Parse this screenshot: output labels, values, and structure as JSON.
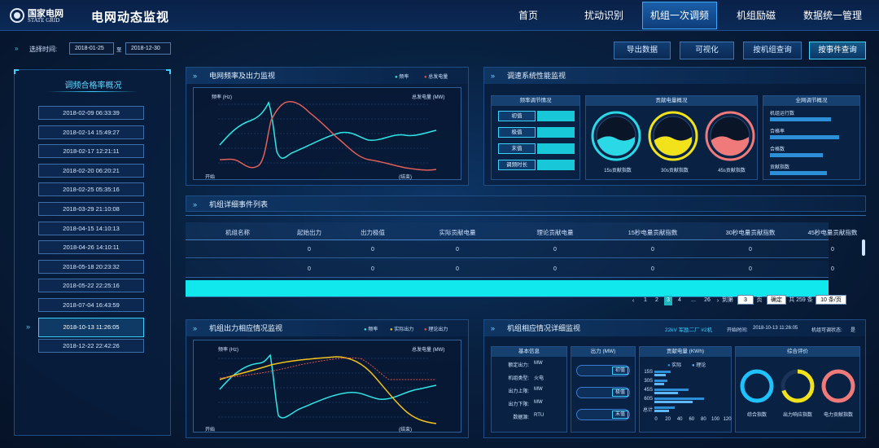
{
  "header": {
    "logo_cn": "国家电网",
    "logo_en": "STATE GRID",
    "app_title": "电网动态监视",
    "nav": [
      "首页",
      "扰动识别",
      "机组一次调频",
      "机组励磁",
      "数据统一管理"
    ],
    "active_nav": "机组一次调频"
  },
  "filter": {
    "label": "选择时间:",
    "start": "2018-01-25",
    "sep": "至",
    "end": "2018-12-30"
  },
  "actions": [
    "导出数据",
    "可视化",
    "按机组查询",
    "按事件查询"
  ],
  "left": {
    "title": "调频合格率概况",
    "items": [
      "2018-02-09 06:33:39",
      "2018-02-14 15:49:27",
      "2018-02-17 12:21:11",
      "2018-02-20 06:20:21",
      "2018-02-25 05:35:16",
      "2018-03-29 21:10:08",
      "2018-04-15 14:10:13",
      "2018-04-26 14:10:11",
      "2018-05-18 20:23:32",
      "2018-05-22 22:25:16",
      "2018-07-04 16:43:59",
      "2018-10-13 11:26:05",
      "2018-12-22 22:42:26"
    ],
    "selected_index": 11
  },
  "freq_panel": {
    "title": "电网频率及出力监视",
    "legend": [
      "频率",
      "总发电量"
    ],
    "y_left_label": "频率 (Hz)",
    "y_right_label": "总发电量 (MW)",
    "x_start": "开始",
    "x_end": "(结束)",
    "series_colors": [
      "#2ee6e6",
      "#e07a7a"
    ]
  },
  "perf_panel": {
    "title": "调速系统性能监视",
    "col1_title": "频率调节情况",
    "col1_rows": [
      "初值",
      "极值",
      "末值",
      "调频时长"
    ],
    "col2_title": "贡献电量概况",
    "gauges": [
      {
        "label": "15s贡献指数",
        "color": "#2ad8e6"
      },
      {
        "label": "30s贡献指数",
        "color": "#f2e21c"
      },
      {
        "label": "45s贡献指数",
        "color": "#f07a7a"
      }
    ],
    "col3_title": "全网调节概况",
    "col3_rows": [
      "机组运行数",
      "合格率",
      "合格数",
      "贡献指数"
    ],
    "col3_fill": [
      0.75,
      0.85,
      0.65,
      0.7
    ]
  },
  "events": {
    "title": "机组详细事件列表",
    "columns": [
      "机组名称",
      "起始出力",
      "出力极值",
      "实际贡献电量",
      "理论贡献电量",
      "15秒电量贡献指数",
      "30秒电量贡献指数",
      "45秒电量贡献指数"
    ],
    "rows": [
      [
        "",
        "0",
        "0",
        "0",
        "0",
        "0",
        "0",
        "0"
      ],
      [
        "",
        "0",
        "0",
        "0",
        "0",
        "0",
        "0",
        "0"
      ],
      [
        "",
        "",
        "",
        "",
        "",
        "",
        "",
        ""
      ]
    ],
    "pagination": {
      "pages": [
        "1",
        "2",
        "3",
        "4",
        "...",
        "26"
      ],
      "current": "3",
      "goto_label": "到第",
      "goto_value": "3",
      "page_label": "页",
      "confirm": "确定",
      "total": "共 259 条",
      "page_size": "10 条/页"
    }
  },
  "unit_panel": {
    "title": "机组出力相应情况监视",
    "legend": [
      "频率",
      "实际出力",
      "理论出力"
    ],
    "y_left_label": "频率 (Hz)",
    "y_right_label": "总发电量 (MW)",
    "x_start": "开始",
    "x_end": "(结束)",
    "series_colors": [
      "#2ee6e6",
      "#f2c21c",
      "#e07a7a"
    ]
  },
  "detail_panel": {
    "title": "机组相应情况详细监视",
    "unit_name": "22kV 军励二厂 #2机",
    "start_label": "开始时间:",
    "start_time": "2018-10-13 11:26:05",
    "judge_label": "机组可调状态:",
    "judge_value": "是",
    "basic_title": "基本信息",
    "basic_rows": [
      {
        "k": "额定出力:",
        "v": "MW"
      },
      {
        "k": "机组类型:",
        "v": "火电"
      },
      {
        "k": "出力上限:",
        "v": "MW"
      },
      {
        "k": "出力下限:",
        "v": "MW"
      },
      {
        "k": "数据源:",
        "v": "RTU"
      }
    ],
    "output_title": "出力 (MW)",
    "output_tags": [
      "初值",
      "极值",
      "末值"
    ],
    "energy_title": "贡献电量 (KWh)",
    "energy_legend": [
      "实际",
      "理论"
    ],
    "energy_cats": [
      "15S",
      "30S",
      "45S",
      "60S",
      "总计"
    ],
    "energy_actual": [
      28,
      22,
      58,
      85,
      35
    ],
    "energy_theory": [
      20,
      16,
      40,
      65,
      25
    ],
    "energy_ticks": [
      "0",
      "20",
      "40",
      "60",
      "80",
      "100",
      "120"
    ],
    "eval_title": "综合评价",
    "eval_labels": [
      "综合指数",
      "出力响应指数",
      "电力贡献指数"
    ],
    "eval_colors": [
      "#1ec2ff",
      "#f2e21c",
      "#f07a7a"
    ],
    "eval_levels": [
      1.0,
      0.7,
      1.0
    ]
  }
}
